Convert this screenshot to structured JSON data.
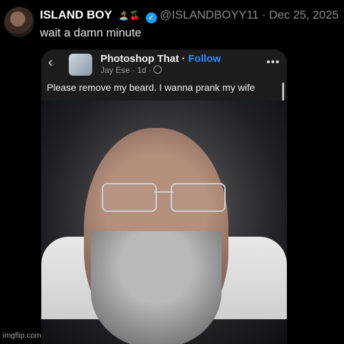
{
  "tweet": {
    "display_name": "ISLAND BOY",
    "emojis": "🏝️🍒",
    "handle": "@ISLANDBOYY11",
    "separator": "·",
    "date": "Dec 25, 2025",
    "text": "wait a damn minute"
  },
  "screenshot": {
    "group_name": "Photoshop That",
    "follow_label": "Follow",
    "author": "Jay Ese",
    "time": "1d",
    "post_text": "Please remove my beard. I wanna prank my wife"
  },
  "watermark": "imgflip.com",
  "icons": {
    "back": "chevron-left-icon",
    "verified": "verified-badge-icon",
    "globe": "globe-icon",
    "more": "more-icon"
  },
  "colors": {
    "background": "#000000",
    "verified": "#1d9bf0",
    "follow": "#2d88ff"
  }
}
